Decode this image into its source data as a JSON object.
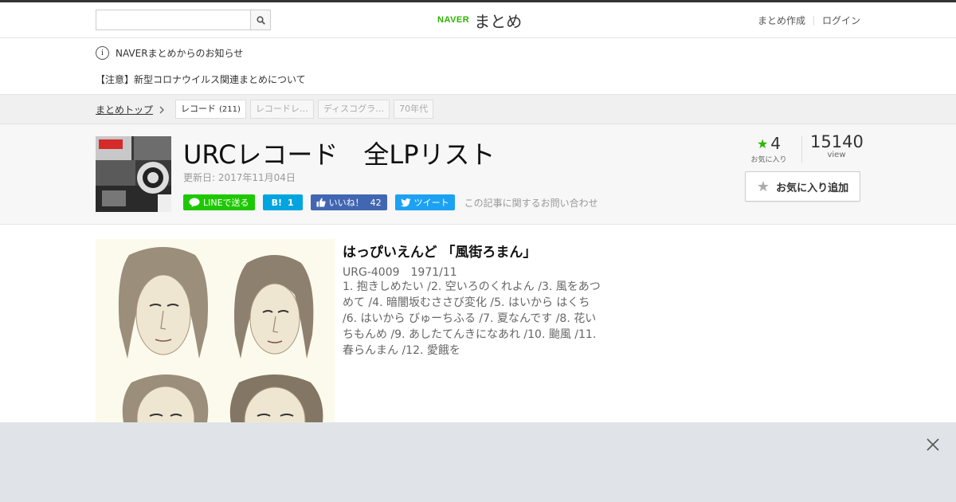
{
  "topbar": {
    "search": {
      "value": "",
      "placeholder": ""
    },
    "logo": {
      "brand": "NAVER",
      "service": "まとめ"
    },
    "links": {
      "create": "まとめ作成",
      "login": "ログイン"
    }
  },
  "notice": {
    "heading": "NAVERまとめからのお知らせ",
    "link": "【注意】新型コロナウイルス関連まとめについて"
  },
  "breadcrumb": {
    "home": "まとめトップ",
    "tags": [
      {
        "label": "レコード",
        "count": "(211)"
      },
      {
        "label": "レコードレ…",
        "count": ""
      },
      {
        "label": "ディスコグラ…",
        "count": ""
      },
      {
        "label": "70年代",
        "count": ""
      }
    ]
  },
  "header": {
    "title": "URCレコード　全LPリスト",
    "updated": "更新日: 2017年11月04日",
    "share": {
      "line": "LINEで送る",
      "hatena_icon": "B!",
      "hatena_count": "1",
      "fb_label": "いいね！",
      "fb_count": "42",
      "tweet": "ツイート"
    },
    "inquiry": "この記事に関するお問い合わせ",
    "stats": {
      "favorites": "4",
      "favorites_label": "お気に入り",
      "views": "15140",
      "views_label": "view"
    },
    "fav_button": "お気に入り追加"
  },
  "item": {
    "title": "はっぴいえんど 「風街ろまん」",
    "meta": "URG-4009　1971/11",
    "tracks": "1. 抱きしめたい /2. 空いろのくれよん /3. 風をあつめて /4. 暗闇坂むささび変化 /5. はいから はくち /6. はいから びゅーちふる /7. 夏なんです /8. 花いちもんめ /9. あしたてんきになあれ /10. 颱風 /11. 春らんまん /12. 愛餓を"
  },
  "colors": {
    "accent_green": "#2db400",
    "line_green": "#1ec800",
    "hatena_blue": "#00a4de",
    "facebook_blue": "#4267b2",
    "twitter_blue": "#1da1f2"
  },
  "icons": [
    "search-icon",
    "info-icon",
    "chevron-right-icon",
    "star-icon",
    "line-icon",
    "facebook-like-icon",
    "twitter-bird-icon",
    "close-icon"
  ]
}
